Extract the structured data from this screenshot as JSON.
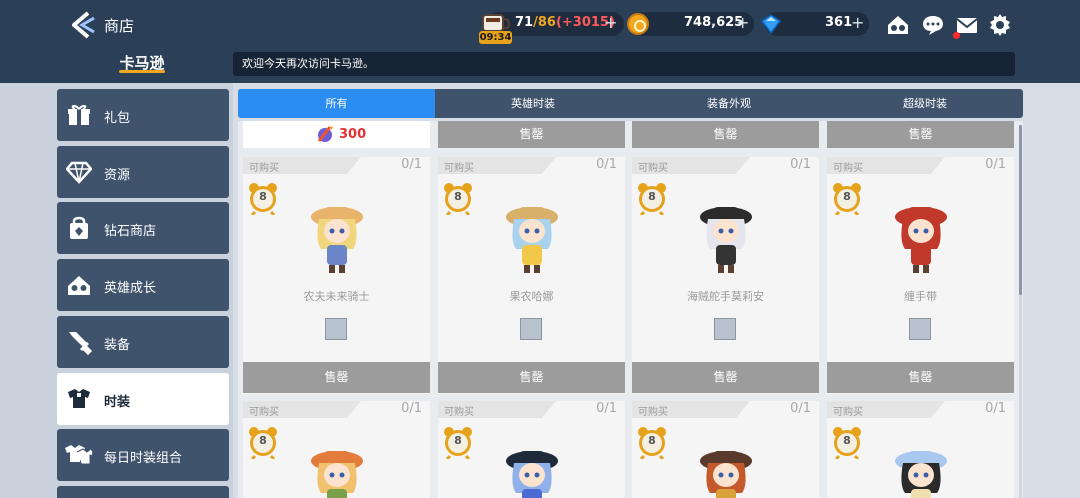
{
  "header": {
    "title": "商店",
    "brand": "卡马逊",
    "notice": "欢迎今天再次访问卡马逊。",
    "stamina": {
      "current": "71",
      "max": "/86",
      "bonus": "(+3015)",
      "timer": "09:34"
    },
    "gold": "748,625",
    "gems": "361",
    "plus": "+"
  },
  "sidebar": {
    "items": [
      {
        "label": "礼包",
        "icon": "gift-icon",
        "active": false
      },
      {
        "label": "资源",
        "icon": "diamond-icon",
        "active": false
      },
      {
        "label": "钻石商店",
        "icon": "shop-bag-icon",
        "active": false
      },
      {
        "label": "英雄成长",
        "icon": "hero-growth-icon",
        "active": false
      },
      {
        "label": "装备",
        "icon": "sword-icon",
        "active": false
      },
      {
        "label": "时装",
        "icon": "costume-icon",
        "active": true
      },
      {
        "label": "每日时装组合",
        "icon": "daily-costume-icon",
        "active": false
      }
    ]
  },
  "tabs": [
    {
      "label": "所有",
      "active": true
    },
    {
      "label": "英雄时装",
      "active": false
    },
    {
      "label": "装备外观",
      "active": false
    },
    {
      "label": "超级时装",
      "active": false
    }
  ],
  "top_row": {
    "price": "300",
    "sold_label": "售罄"
  },
  "cards": [
    {
      "tag": "可购买",
      "limit": "0/1",
      "timer": "8",
      "name": "农夫未来骑士",
      "sold": "售罄",
      "hat": "#e8b36a",
      "hair": "#f1d67e",
      "body": "#6b86c8"
    },
    {
      "tag": "可购买",
      "limit": "0/1",
      "timer": "8",
      "name": "果农哈娜",
      "sold": "售罄",
      "hat": "#d9b06a",
      "hair": "#a9d2ef",
      "body": "#f2c84b"
    },
    {
      "tag": "可购买",
      "limit": "0/1",
      "timer": "8",
      "name": "海贼舵手莫莉安",
      "sold": "售罄",
      "hat": "#2b2b2b",
      "hair": "#e5e5f0",
      "body": "#333333"
    },
    {
      "tag": "可购买",
      "limit": "0/1",
      "timer": "8",
      "name": "缠手带",
      "sold": "售罄",
      "hat": "#c0392b",
      "hair": "#c0392b",
      "body": "#c0392b"
    },
    {
      "tag": "可购买",
      "limit": "0/1",
      "timer": "8",
      "name": "",
      "sold": "",
      "hat": "#e27b3b",
      "hair": "#f2c16e",
      "body": "#7aa04a"
    },
    {
      "tag": "可购买",
      "limit": "0/1",
      "timer": "8",
      "name": "",
      "sold": "",
      "hat": "#1f2a3b",
      "hair": "#8fb0e8",
      "body": "#4a6bd1"
    },
    {
      "tag": "可购买",
      "limit": "0/1",
      "timer": "8",
      "name": "",
      "sold": "",
      "hat": "#5a3a2a",
      "hair": "#c45a2c",
      "body": "#d9a33a"
    },
    {
      "tag": "可购买",
      "limit": "0/1",
      "timer": "8",
      "name": "",
      "sold": "",
      "hat": "#a8c8ef",
      "hair": "#2a2a2a",
      "body": "#f0e0b0"
    }
  ]
}
